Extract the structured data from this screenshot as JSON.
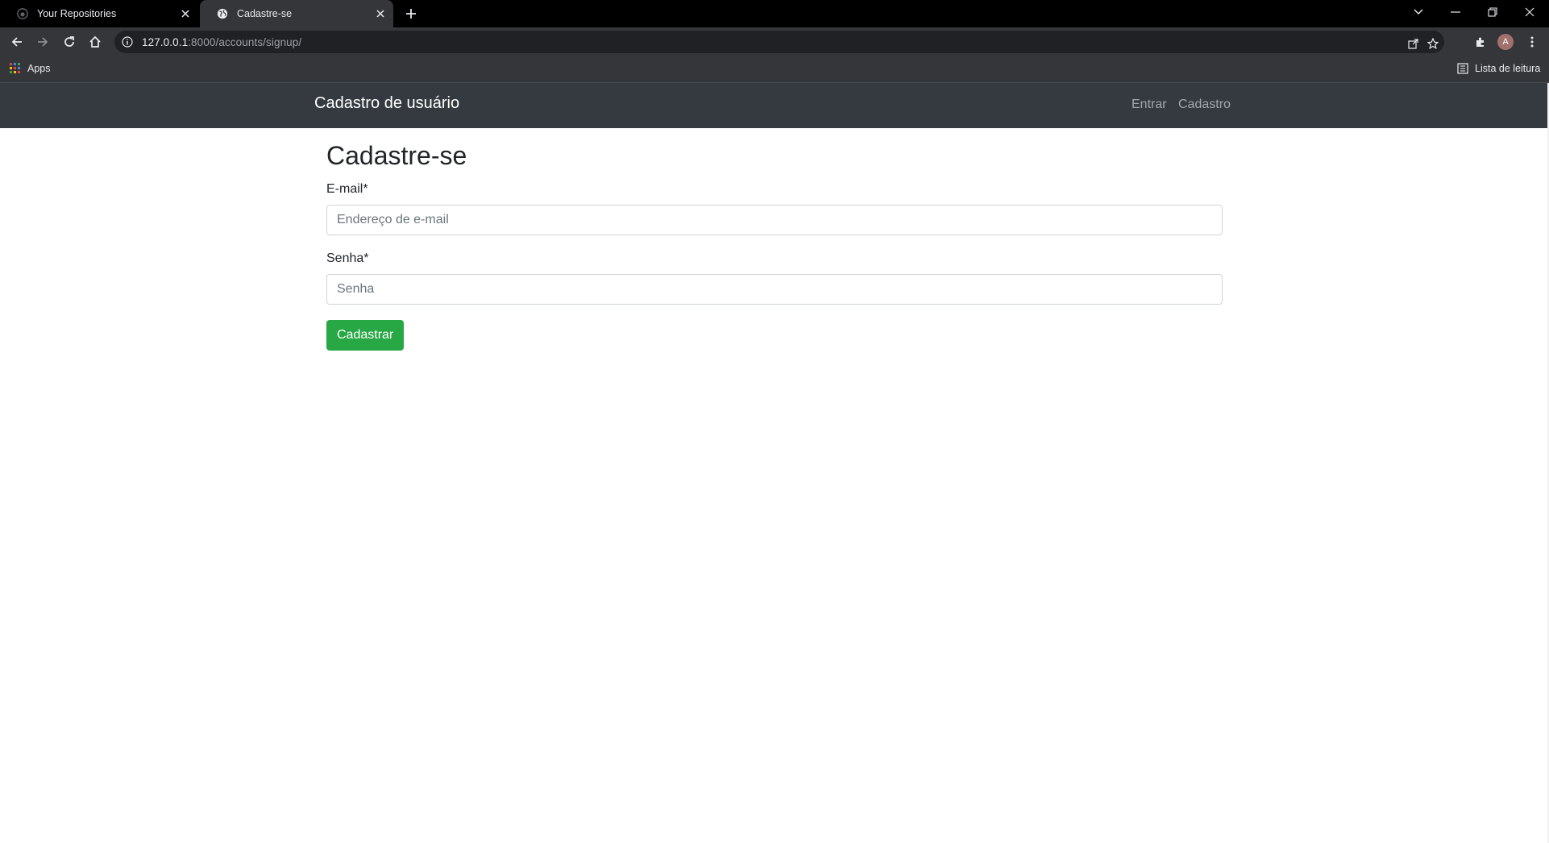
{
  "browser": {
    "tabs": [
      {
        "title": "Your Repositories",
        "active": false,
        "favicon": "github-icon"
      },
      {
        "title": "Cadastre-se",
        "active": true,
        "favicon": "globe-icon"
      }
    ],
    "url_host": "127.0.0.1",
    "url_rest": ":8000/accounts/signup/",
    "profile_initial": "A",
    "bookmarks": {
      "apps_label": "Apps",
      "reading_list_label": "Lista de leitura"
    }
  },
  "navbar": {
    "brand": "Cadastro de usuário",
    "links": [
      "Entrar",
      "Cadastro"
    ],
    "background": "#343a40"
  },
  "form": {
    "title": "Cadastre-se",
    "email_label": "E-mail*",
    "email_placeholder": "Endereço de e-mail",
    "password_label": "Senha*",
    "password_placeholder": "Senha",
    "submit_label": "Cadastrar",
    "submit_color": "#28a745"
  }
}
